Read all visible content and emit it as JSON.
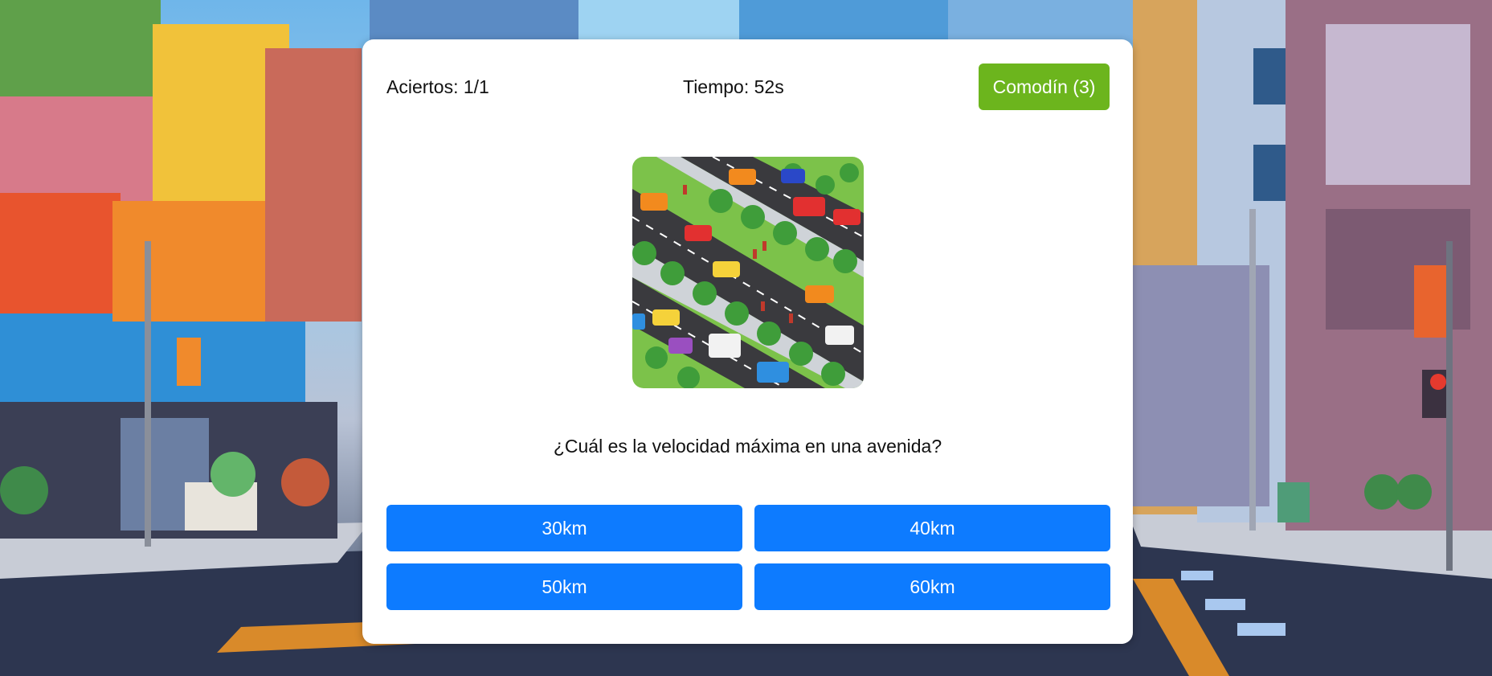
{
  "header": {
    "score_label": "Aciertos: 1/1",
    "timer_label": "Tiempo: 52s",
    "joker_button": "Comodín (3)"
  },
  "question": {
    "image_icon": "city-avenue-traffic-illustration",
    "text": "¿Cuál es la velocidad máxima en una avenida?"
  },
  "answers": [
    "30km",
    "40km",
    "50km",
    "60km"
  ],
  "colors": {
    "answer_button": "#0d7bff",
    "joker_button": "#6cb51d",
    "card": "#ffffff"
  }
}
